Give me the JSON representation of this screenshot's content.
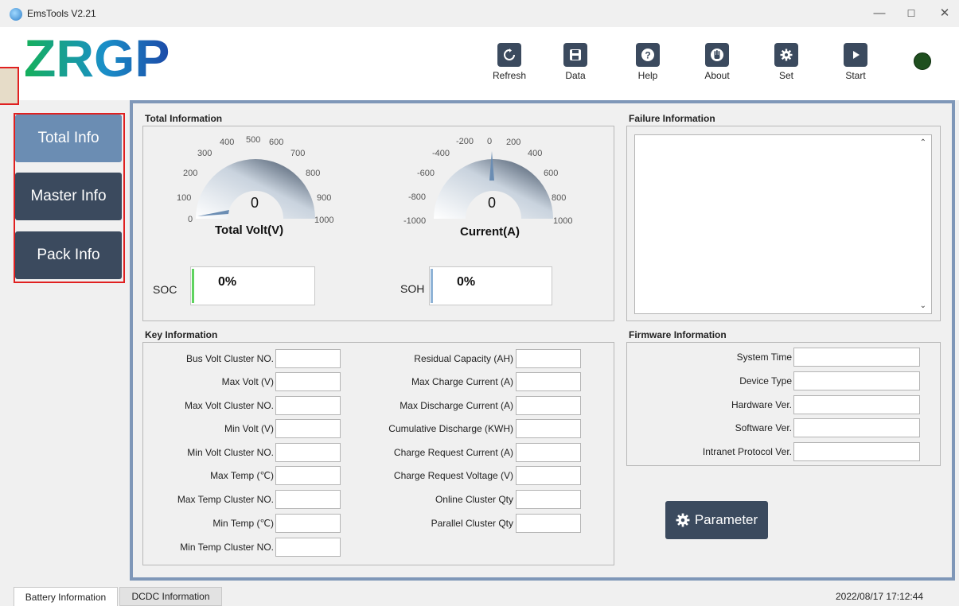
{
  "window": {
    "title": "EmsTools V2.21"
  },
  "logo": {
    "text": "ZRGP"
  },
  "toolbar": [
    {
      "label": "Refresh",
      "icon": "refresh-icon"
    },
    {
      "label": "Data",
      "icon": "save-icon"
    },
    {
      "label": "Help",
      "icon": "help-icon"
    },
    {
      "label": "About",
      "icon": "hand-icon"
    },
    {
      "label": "Set",
      "icon": "gear-icon"
    },
    {
      "label": "Start",
      "icon": "play-icon"
    }
  ],
  "sidebar": {
    "items": [
      {
        "label": "Total Info"
      },
      {
        "label": "Master Info"
      },
      {
        "label": "Pack Info"
      }
    ]
  },
  "total_info": {
    "title": "Total Information",
    "volt_gauge": {
      "label": "Total Volt(V)",
      "value": "0",
      "ticks": [
        "0",
        "100",
        "200",
        "300",
        "400",
        "500",
        "600",
        "700",
        "800",
        "900",
        "1000"
      ]
    },
    "current_gauge": {
      "label": "Current(A)",
      "value": "0",
      "ticks": [
        "-1000",
        "-800",
        "-600",
        "-400",
        "-200",
        "0",
        "200",
        "400",
        "600",
        "800",
        "1000"
      ]
    },
    "soc": {
      "label": "SOC",
      "value": "0%"
    },
    "soh": {
      "label": "SOH",
      "value": "0%"
    }
  },
  "failure_info": {
    "title": "Failure Information"
  },
  "key_info": {
    "title": "Key Information",
    "left_fields": [
      "Bus Volt Cluster NO.",
      "Max Volt (V)",
      "Max Volt Cluster NO.",
      "Min Volt (V)",
      "Min Volt Cluster NO.",
      "Max Temp (℃)",
      "Max Temp Cluster NO.",
      "Min Temp (℃)",
      "Min Temp Cluster NO."
    ],
    "right_fields": [
      "Residual Capacity (AH)",
      "Max Charge Current (A)",
      "Max Discharge Current (A)",
      "Cumulative Discharge (KWH)",
      "Charge Request Current (A)",
      "Charge Request Voltage (V)",
      "Online Cluster Qty",
      "Parallel Cluster Qty"
    ]
  },
  "firmware_info": {
    "title": "Firmware Information",
    "fields": [
      "System Time",
      "Device Type",
      "Hardware Ver.",
      "Software Ver.",
      "Intranet Protocol Ver."
    ]
  },
  "parameter_button": {
    "label": "Parameter"
  },
  "bottom_tabs": [
    {
      "label": "Battery Information"
    },
    {
      "label": "DCDC Information"
    }
  ],
  "status": {
    "datetime": "2022/08/17 17:12:44"
  },
  "colors": {
    "accent": "#3b4a5e",
    "active_nav": "#6b8db3",
    "frame": "#7f97b8",
    "highlight": "#e02020"
  }
}
